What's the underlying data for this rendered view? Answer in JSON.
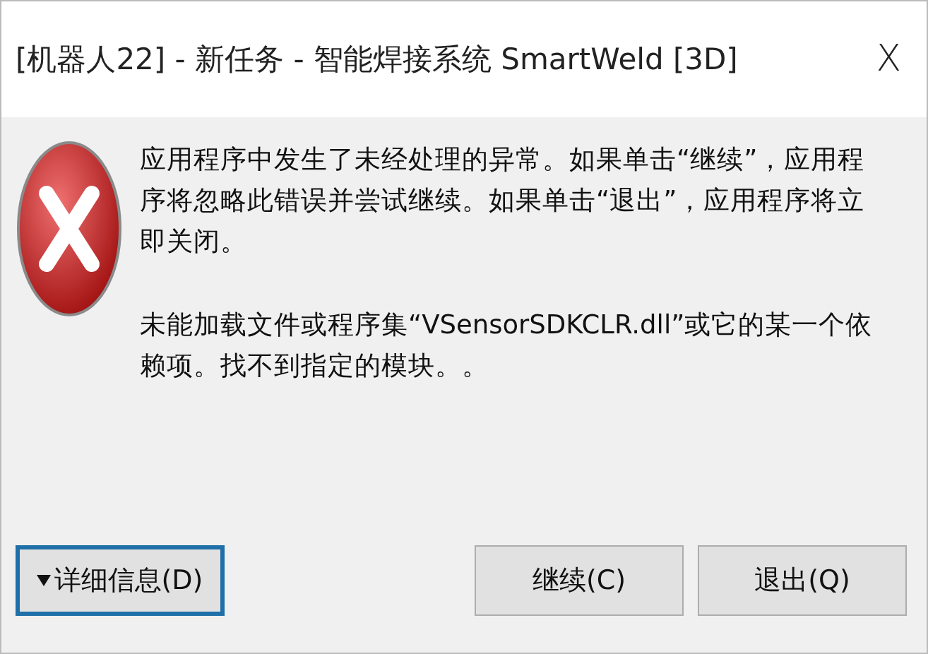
{
  "window": {
    "title": "[机器人22] - 新任务 - 智能焊接系统 SmartWeld [3D]",
    "close": "X"
  },
  "message": {
    "paragraphs": [
      "应用程序中发生了未经处理的异常。如果单击“继续”，应用程序将忽略此错误并尝试继续。如果单击“退出”，应用程序将立即关闭。",
      "未能加载文件或程序集“VSensorSDKCLR.dll”或它的某一个依赖项。找不到指定的模块。。"
    ]
  },
  "buttons": [
    {
      "kind": "details",
      "label": "详细信息(D)",
      "focused": true
    },
    {
      "kind": "plain",
      "label": "继续(C)",
      "focused": false
    },
    {
      "kind": "plain",
      "label": "退出(Q)",
      "focused": false
    }
  ]
}
